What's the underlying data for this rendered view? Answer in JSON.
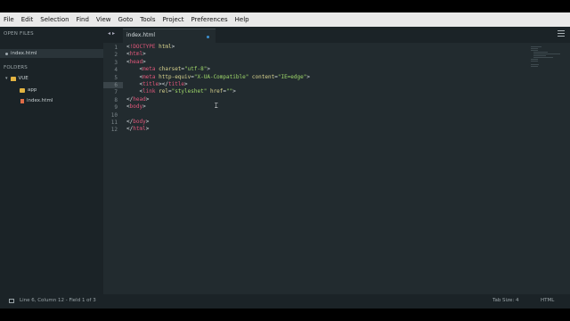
{
  "menu": [
    "File",
    "Edit",
    "Selection",
    "Find",
    "View",
    "Goto",
    "Tools",
    "Project",
    "Preferences",
    "Help"
  ],
  "sidebar": {
    "open_files_heading": "OPEN FILES",
    "open_file": "index.html",
    "folders_heading": "FOLDERS",
    "root_folder": "VUE",
    "items": [
      "app",
      "index.html"
    ]
  },
  "tabs": [
    {
      "label": "index.html",
      "dirty": true
    }
  ],
  "editor": {
    "line_numbers": [
      "1",
      "2",
      "3",
      "4",
      "5",
      "6",
      "7",
      "8",
      "9",
      "10",
      "11",
      "12"
    ],
    "highlighted_line": "6",
    "lines": [
      [
        [
          "<",
          "t-punct"
        ],
        [
          "!DOCTYPE",
          "t-doctype"
        ],
        [
          " html",
          "t-attr"
        ],
        [
          ">",
          "t-punct"
        ]
      ],
      [
        [
          "<",
          "t-punct"
        ],
        [
          "html",
          "t-tag"
        ],
        [
          ">",
          "t-punct"
        ]
      ],
      [
        [
          "<",
          "t-punct"
        ],
        [
          "head",
          "t-tag"
        ],
        [
          ">",
          "t-punct"
        ]
      ],
      [
        [
          "    <",
          "t-punct"
        ],
        [
          "meta",
          "t-tag"
        ],
        [
          " charset",
          "t-attr"
        ],
        [
          "=",
          "t-punct"
        ],
        [
          "\"utf-8\"",
          "t-str"
        ],
        [
          ">",
          "t-punct"
        ]
      ],
      [
        [
          "    <",
          "t-punct"
        ],
        [
          "meta",
          "t-tag"
        ],
        [
          " http-equiv",
          "t-attr"
        ],
        [
          "=",
          "t-punct"
        ],
        [
          "\"X-UA-Compatible\"",
          "t-str"
        ],
        [
          " content",
          "t-attr"
        ],
        [
          "=",
          "t-punct"
        ],
        [
          "\"IE=edge\"",
          "t-str"
        ],
        [
          ">",
          "t-punct"
        ]
      ],
      [
        [
          "    <",
          "t-punct"
        ],
        [
          "title",
          "t-tag"
        ],
        [
          "></",
          "t-punct"
        ],
        [
          "title",
          "t-tag"
        ],
        [
          ">",
          "t-punct"
        ]
      ],
      [
        [
          "    <",
          "t-punct"
        ],
        [
          "link",
          "t-tag"
        ],
        [
          " rel",
          "t-attr"
        ],
        [
          "=",
          "t-punct"
        ],
        [
          "\"styleshe",
          "t-str"
        ],
        [
          "t\"",
          "t-str"
        ],
        [
          " href",
          "t-attr"
        ],
        [
          "=",
          "t-punct"
        ],
        [
          "\"\"",
          "t-str"
        ],
        [
          ">",
          "t-punct"
        ]
      ],
      [
        [
          "</",
          "t-punct"
        ],
        [
          "head",
          "t-tag"
        ],
        [
          ">",
          "t-punct"
        ]
      ],
      [
        [
          "<",
          "t-punct"
        ],
        [
          "body",
          "t-tag"
        ],
        [
          ">",
          "t-punct"
        ]
      ],
      [],
      [
        [
          "</",
          "t-punct"
        ],
        [
          "body",
          "t-tag"
        ],
        [
          ">",
          "t-punct"
        ]
      ],
      [
        [
          "</",
          "t-punct"
        ],
        [
          "html",
          "t-tag"
        ],
        [
          ">",
          "t-punct"
        ]
      ]
    ]
  },
  "status": {
    "position": "Line 6, Column 12 - Field 1 of 3",
    "tab_size": "Tab Size: 4",
    "syntax": "HTML"
  },
  "colors": {
    "background": "#222b2f",
    "sidebar": "#1b2327",
    "tag": "#e0577a",
    "attribute": "#dad48e",
    "string": "#9fd86a",
    "dirty_indicator": "#3b8fd0"
  }
}
